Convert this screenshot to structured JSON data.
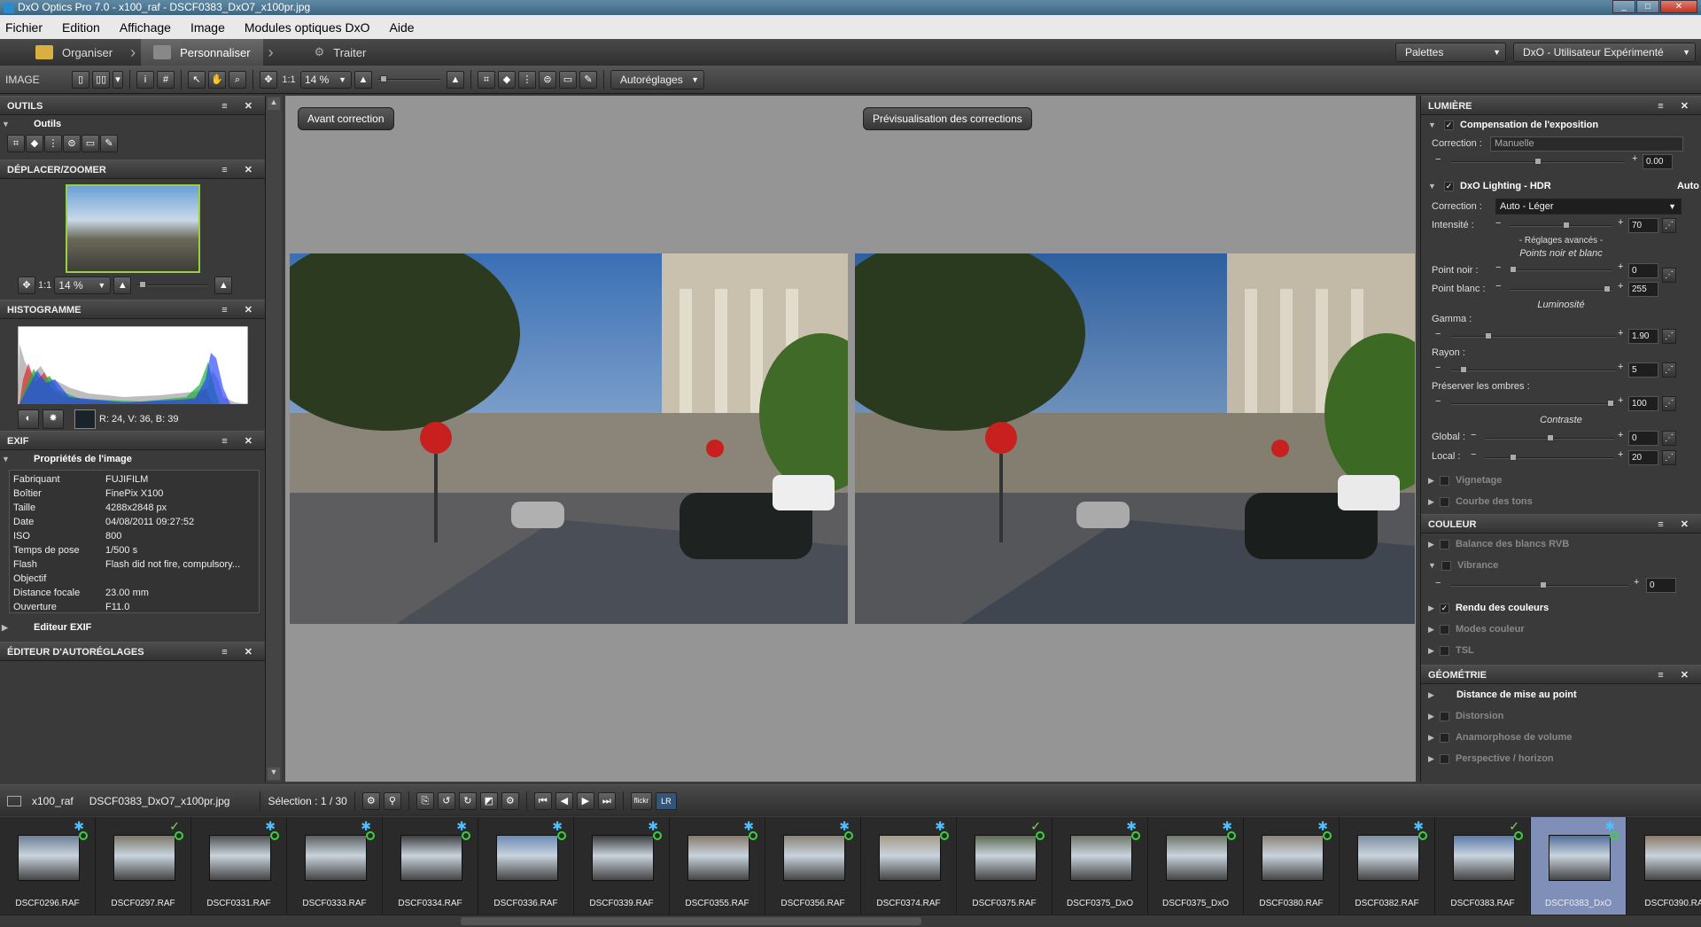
{
  "window": {
    "title": "DxO Optics Pro 7.0 - x100_raf - DSCF0383_DxO7_x100pr.jpg",
    "min": "_",
    "max": "□",
    "close": "✕"
  },
  "menu": [
    "Fichier",
    "Edition",
    "Affichage",
    "Image",
    "Modules optiques DxO",
    "Aide"
  ],
  "modes": {
    "organize": "Organiser",
    "customize": "Personnaliser",
    "process": "Traiter"
  },
  "palettes": "Palettes",
  "workspace": "DxO - Utilisateur Expérimenté",
  "toolbar": {
    "section": "IMAGE",
    "zoom11": "1:1",
    "zoom": "14 %",
    "auto": "Autoréglages"
  },
  "left": {
    "tools_header": "OUTILS",
    "tools_sub": "Outils",
    "move_header": "DÉPLACER/ZOOMER",
    "move_zoom11": "1:1",
    "move_zoom": "14 %",
    "hist_header": "HISTOGRAMME",
    "hist_values": "R: 24, V: 36, B: 39",
    "exif_header": "EXIF",
    "exif_sub": "Propriétés de l'image",
    "exif": [
      [
        "Fabriquant",
        "FUJIFILM"
      ],
      [
        "Boîtier",
        "FinePix X100"
      ],
      [
        "Taille",
        "4288x2848 px"
      ],
      [
        "Date",
        "04/08/2011 09:27:52"
      ],
      [
        "ISO",
        "800"
      ],
      [
        "Temps de pose",
        "1/500 s"
      ],
      [
        "Flash",
        "Flash did not fire, compulsory..."
      ],
      [
        "Objectif",
        ""
      ],
      [
        "Distance focale",
        "23.00 mm"
      ],
      [
        "Ouverture",
        "F11.0"
      ]
    ],
    "exif_editor": "Editeur EXIF",
    "auto_editor": "ÉDITEUR D'AUTORÉGLAGES"
  },
  "view": {
    "before": "Avant correction",
    "preview": "Prévisualisation des corrections"
  },
  "right": {
    "light_header": "LUMIÈRE",
    "exposure": {
      "title": "Compensation de l'exposition",
      "label": "Correction :",
      "value": "Manuelle",
      "amount": "0.00"
    },
    "hdr": {
      "title": "DxO Lighting - HDR",
      "auto": "Auto",
      "label": "Correction :",
      "value": "Auto - Léger",
      "intensity_label": "Intensité :",
      "intensity": "70",
      "advanced": "- Réglages avancés -",
      "points": "Points noir et blanc",
      "black_label": "Point noir :",
      "black": "0",
      "white_label": "Point blanc :",
      "white": "255",
      "luminosity": "Luminosité",
      "gamma_label": "Gamma :",
      "gamma": "1.90",
      "radius_label": "Rayon :",
      "radius": "5",
      "shadows_label": "Préserver les ombres :",
      "shadows": "100",
      "contrast": "Contraste",
      "global_label": "Global :",
      "global": "0",
      "local_label": "Local :",
      "local": "20"
    },
    "vignetting": "Vignetage",
    "tone_curve": "Courbe des tons",
    "color_header": "COULEUR",
    "wb": "Balance des blancs RVB",
    "vibrance": "Vibrance",
    "vibrance_val": "0",
    "rendering": "Rendu des couleurs",
    "color_modes": "Modes couleur",
    "hsl": "TSL",
    "geom_header": "GÉOMÉTRIE",
    "focus_dist": "Distance de mise au point",
    "distortion": "Distorsion",
    "anamorph": "Anamorphose de volume",
    "perspective": "Perspective / horizon"
  },
  "filmbar": {
    "folder": "x100_raf",
    "file": "DSCF0383_DxO7_x100pr.jpg",
    "selection": "Sélection : 1 / 30",
    "flickr": "flickr",
    "lr": "LR"
  },
  "thumbs": [
    {
      "name": "DSCF0296.RAF",
      "mark": "star"
    },
    {
      "name": "DSCF0297.RAF",
      "mark": "check"
    },
    {
      "name": "DSCF0331.RAF",
      "mark": "star"
    },
    {
      "name": "DSCF0333.RAF",
      "mark": "star"
    },
    {
      "name": "DSCF0334.RAF",
      "mark": "star"
    },
    {
      "name": "DSCF0336.RAF",
      "mark": "star"
    },
    {
      "name": "DSCF0339.RAF",
      "mark": "star"
    },
    {
      "name": "DSCF0355.RAF",
      "mark": "star"
    },
    {
      "name": "DSCF0356.RAF",
      "mark": "star"
    },
    {
      "name": "DSCF0374.RAF",
      "mark": "star"
    },
    {
      "name": "DSCF0375.RAF",
      "mark": "check"
    },
    {
      "name": "DSCF0375_DxO",
      "mark": "star"
    },
    {
      "name": "DSCF0375_DxO",
      "mark": "star"
    },
    {
      "name": "DSCF0380.RAF",
      "mark": "star"
    },
    {
      "name": "DSCF0382.RAF",
      "mark": "star"
    },
    {
      "name": "DSCF0383.RAF",
      "mark": "check"
    },
    {
      "name": "DSCF0383_DxO",
      "mark": "star"
    },
    {
      "name": "DSCF0390.RA",
      "mark": ""
    }
  ]
}
